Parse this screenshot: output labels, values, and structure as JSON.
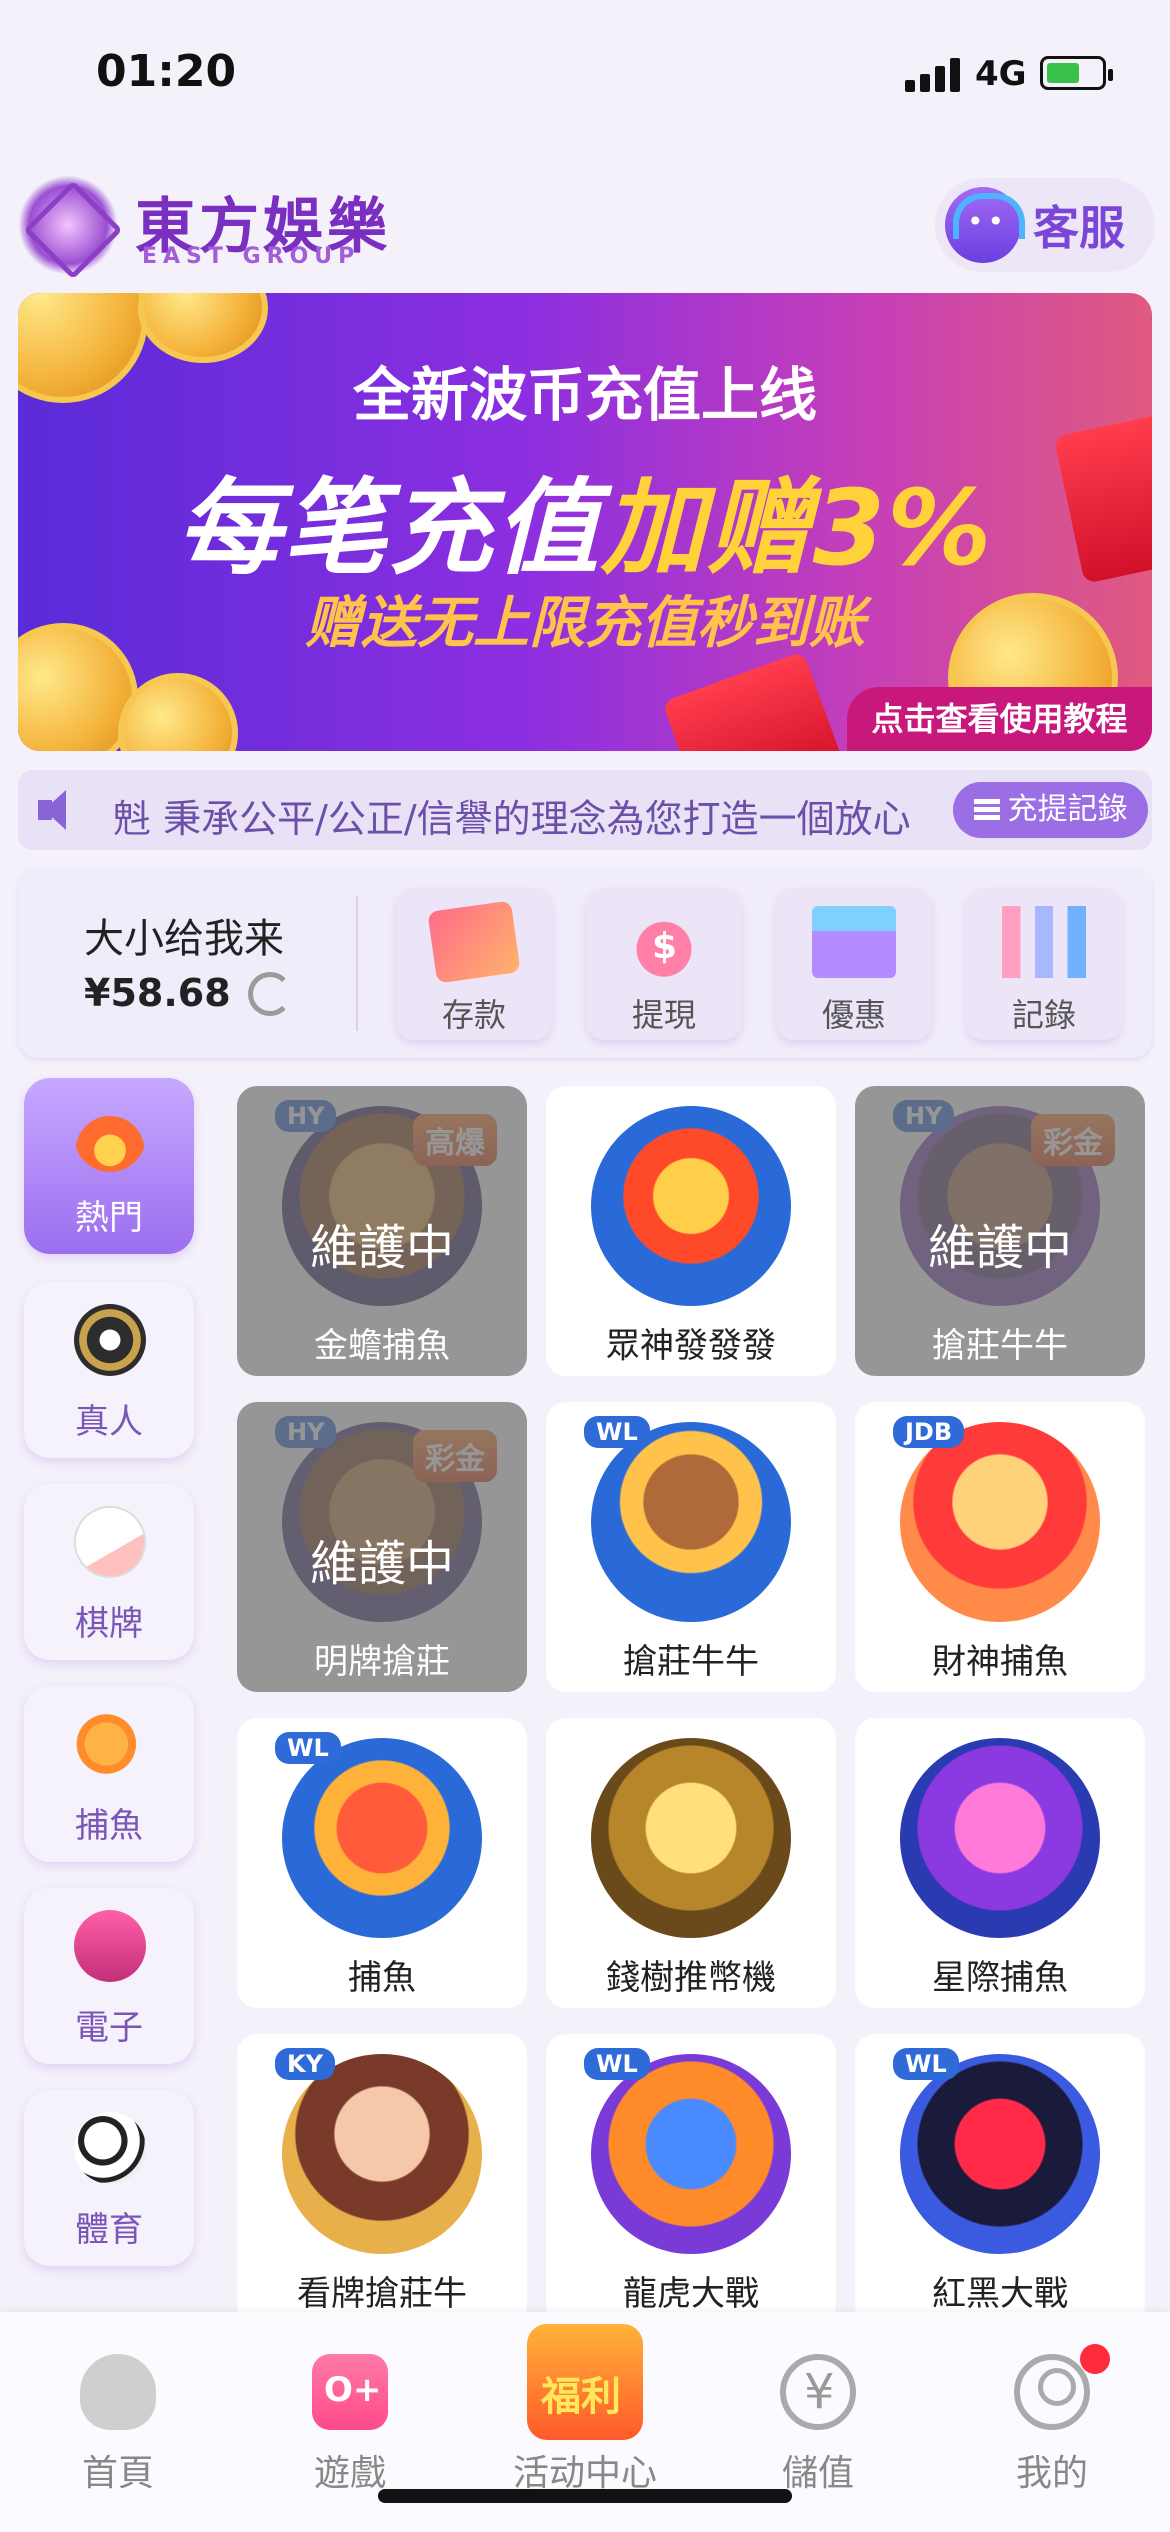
{
  "status_bar": {
    "time": "01:20",
    "network": "4G"
  },
  "header": {
    "brand_title": "東方娛樂",
    "brand_subtitle": "EAST GROUP",
    "customer_service_label": "客服"
  },
  "banner": {
    "line1": "全新波币充值上线",
    "line2_prefix": "每笔充值",
    "line2_highlight": "加赠3%",
    "line3": "赠送无上限充值秒到账",
    "cta": "点击查看使用教程"
  },
  "marquee": {
    "text": "𣁽 秉承公平/公正/信譽的理念為您打造一個放心",
    "records_button": "充提記錄"
  },
  "wallet": {
    "username": "大小给我来",
    "balance": "¥58.68",
    "actions": [
      {
        "label": "存款",
        "icon": "card-icon"
      },
      {
        "label": "提現",
        "icon": "money-bag-icon"
      },
      {
        "label": "優惠",
        "icon": "gift-icon"
      },
      {
        "label": "記錄",
        "icon": "bar-chart-icon"
      }
    ]
  },
  "categories": [
    {
      "label": "熱門",
      "icon": "fire-icon",
      "active": true
    },
    {
      "label": "真人",
      "icon": "poker-chip-icon",
      "active": false
    },
    {
      "label": "棋牌",
      "icon": "playing-card-icon",
      "active": false
    },
    {
      "label": "捕魚",
      "icon": "fish-icon",
      "active": false
    },
    {
      "label": "電子",
      "icon": "slot-machine-icon",
      "active": false
    },
    {
      "label": "體育",
      "icon": "soccer-ball-icon",
      "active": false
    }
  ],
  "maintenance_label": "維護中",
  "games": [
    {
      "name": "金蟾捕魚",
      "badge": "HY",
      "tag": "高爆",
      "maintenance": true
    },
    {
      "name": "眾神發發發",
      "badge": "",
      "tag": "",
      "maintenance": false
    },
    {
      "name": "搶莊牛牛",
      "badge": "HY",
      "tag": "彩金",
      "maintenance": true
    },
    {
      "name": "明牌搶莊",
      "badge": "HY",
      "tag": "彩金",
      "maintenance": true
    },
    {
      "name": "搶莊牛牛",
      "badge": "WL",
      "tag": "",
      "maintenance": false
    },
    {
      "name": "財神捕魚",
      "badge": "JDB",
      "tag": "",
      "maintenance": false
    },
    {
      "name": "捕魚",
      "badge": "WL",
      "tag": "",
      "maintenance": false
    },
    {
      "name": "錢樹推幣機",
      "badge": "",
      "tag": "",
      "maintenance": false
    },
    {
      "name": "星際捕魚",
      "badge": "",
      "tag": "",
      "maintenance": false
    },
    {
      "name": "看牌搶莊牛",
      "badge": "KY",
      "tag": "",
      "maintenance": false
    },
    {
      "name": "龍虎大戰",
      "badge": "WL",
      "tag": "",
      "maintenance": false
    },
    {
      "name": "紅黑大戰",
      "badge": "WL",
      "tag": "",
      "maintenance": false
    }
  ],
  "bottom_nav": [
    {
      "label": "首頁",
      "icon": "home-icon"
    },
    {
      "label": "遊戲",
      "icon": "gamepad-icon"
    },
    {
      "label": "活动中心",
      "icon": "promo-icon"
    },
    {
      "label": "儲值",
      "icon": "deposit-icon"
    },
    {
      "label": "我的",
      "icon": "profile-icon"
    }
  ]
}
